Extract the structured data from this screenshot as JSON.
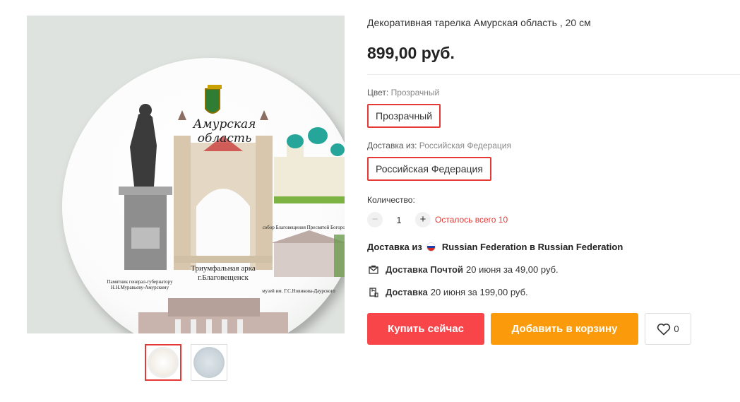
{
  "product": {
    "title": "Декоративная тарелка Амурская область , 20 см",
    "price": "899,00 руб."
  },
  "plate": {
    "region_title": "Амурская область",
    "arch_caption": "Триумфальная арка г.Благовещенск",
    "monument_caption": "Памятник генерал-губернатору Н.Н.Муравьеву-Амурскому",
    "cathedral_caption": "собор Благовещения Пресвятой Богородицы",
    "museum_caption": "музей им. Г.С.Новикова-Даурского"
  },
  "options": {
    "color_label": "Цвет:",
    "color_value": "Прозрачный",
    "color_chip": "Прозрачный",
    "ship_label": "Доставка из:",
    "ship_value": "Российская Федерация",
    "ship_chip": "Российская Федерация"
  },
  "quantity": {
    "label": "Количество:",
    "minus": "−",
    "value": "1",
    "plus": "+",
    "stock": "Осталось всего 10"
  },
  "shipping": {
    "from_prefix": "Доставка из",
    "from_text": "Russian Federation в Russian Federation",
    "post_label": "Доставка Почтой",
    "post_text": "20 июня за 49,00 руб.",
    "courier_label": "Доставка",
    "courier_text": "20 июня за 199,00 руб."
  },
  "actions": {
    "buy_now": "Купить сейчас",
    "add_to_cart": "Добавить в корзину",
    "wishlist_count": "0"
  },
  "colors": {
    "accent_red": "#f7454a",
    "accent_orange": "#fb9a0a",
    "selection_border": "#e53935"
  },
  "icons": [
    "heart-icon",
    "mail-icon",
    "courier-icon",
    "russia-flag-icon"
  ]
}
